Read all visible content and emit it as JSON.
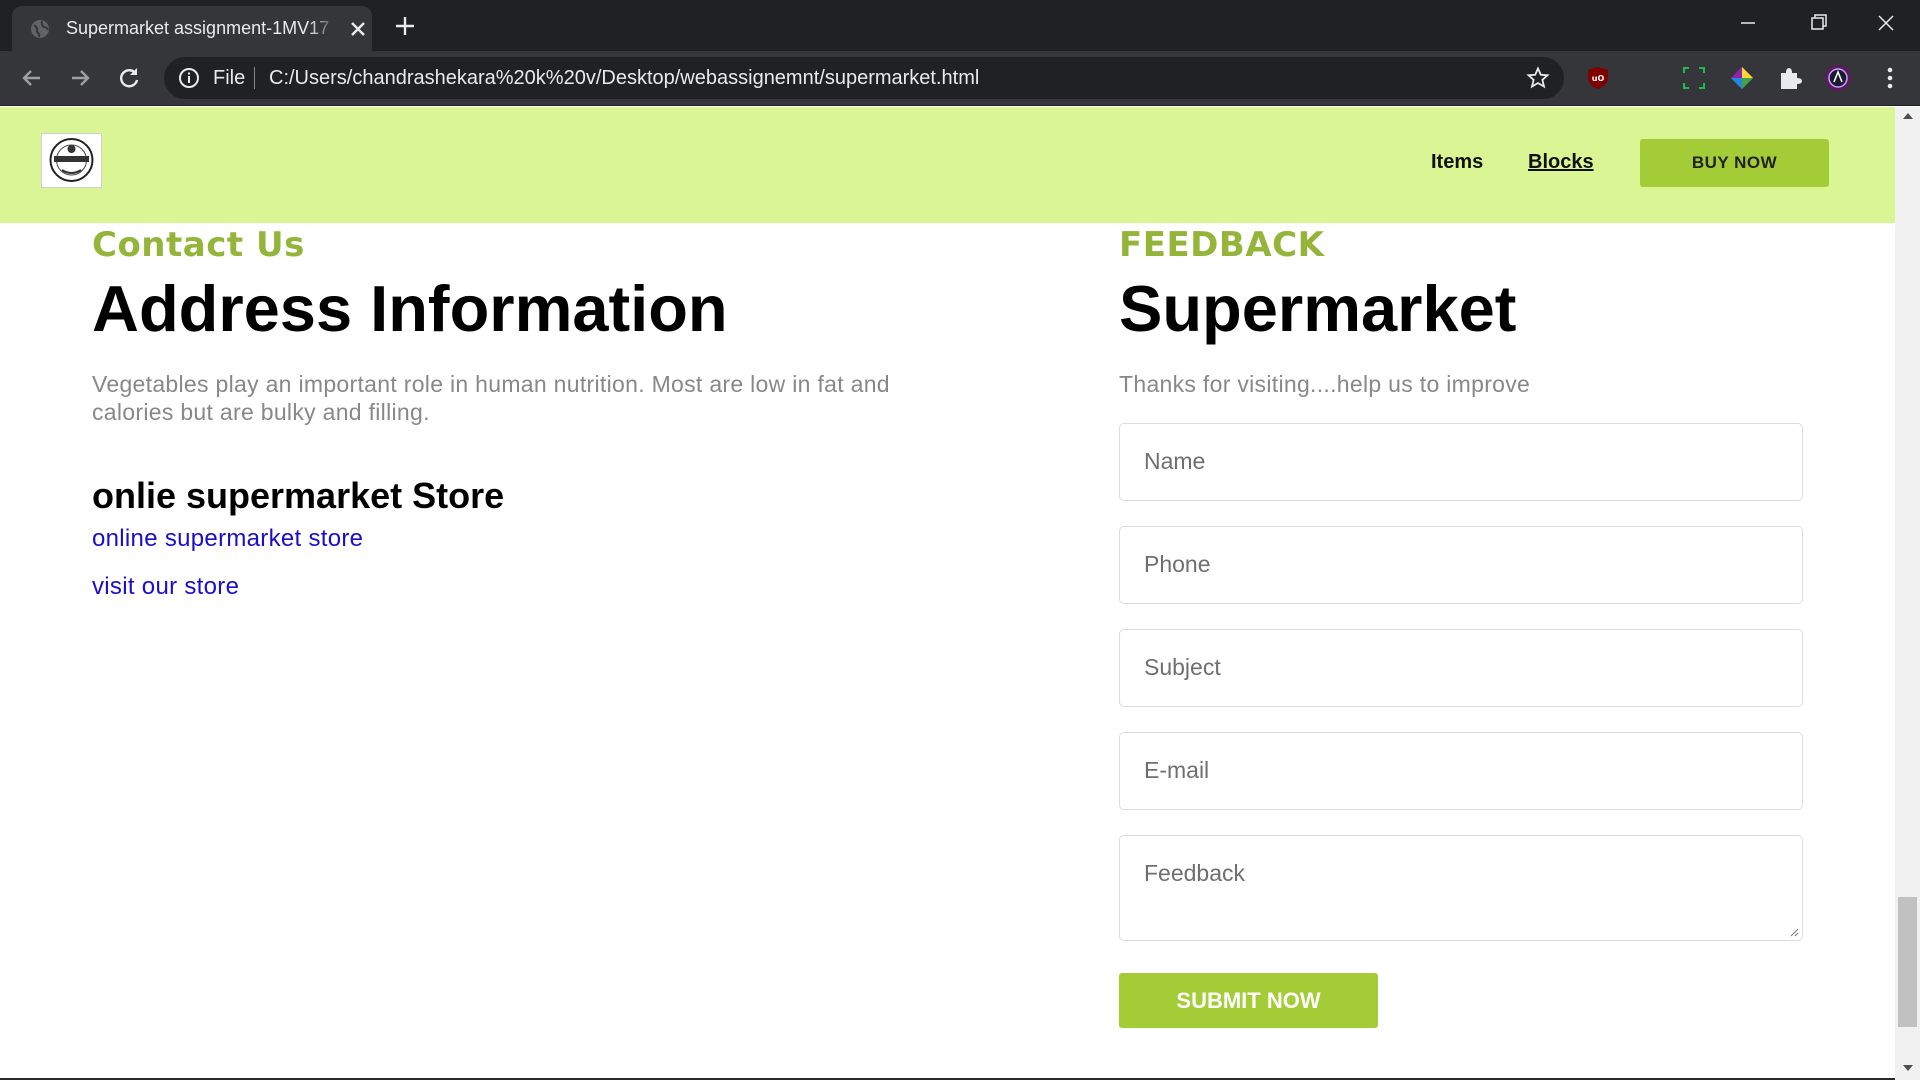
{
  "browser": {
    "tab_title": "Supermarket assignment-1MV17",
    "url_scheme": "File",
    "url": "C:/Users/chandrashekara%20k%20v/Desktop/webassignemnt/supermarket.html"
  },
  "header": {
    "nav": {
      "items_label": "Items",
      "blocks_label": "Blocks"
    },
    "buy_label": "BUY NOW"
  },
  "contact": {
    "eyebrow": "Contact Us",
    "title": "Address Information",
    "text": "Vegetables play an important role in human nutrition. Most are low in fat and calories but are bulky and filling.",
    "store_title": "onlie supermarket Store",
    "links": [
      "online supermarket store",
      "visit our store"
    ]
  },
  "feedback": {
    "eyebrow": "FEEDBACK",
    "title": "Supermarket",
    "text": "Thanks for visiting....help us to improve",
    "fields": {
      "name": "Name",
      "phone": "Phone",
      "subject": "Subject",
      "email": "E-mail",
      "message": "Feedback"
    },
    "submit_label": "SUBMIT NOW"
  },
  "colors": {
    "header_bg": "#d9f594",
    "accent": "#a3cc37",
    "eyebrow": "#94b43a",
    "link": "#1a0dcc"
  }
}
